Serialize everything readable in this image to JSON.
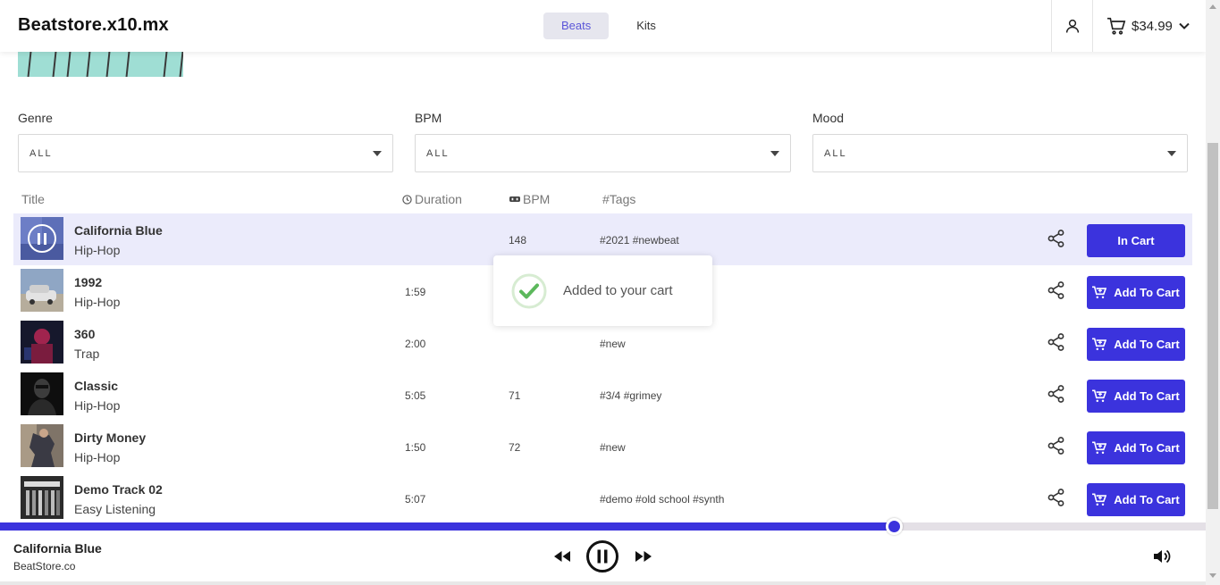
{
  "header": {
    "brand": "Beatstore.x10.mx",
    "tabs": [
      {
        "label": "Beats",
        "active": true
      },
      {
        "label": "Kits",
        "active": false
      }
    ],
    "cart_total": "$34.99"
  },
  "filters": {
    "genre": {
      "label": "Genre",
      "value": "ALL"
    },
    "bpm": {
      "label": "BPM",
      "value": "ALL"
    },
    "mood": {
      "label": "Mood",
      "value": "ALL"
    }
  },
  "table": {
    "headers": {
      "title": "Title",
      "duration": "Duration",
      "bpm": "BPM",
      "tags": "#Tags"
    },
    "rows": [
      {
        "title": "California Blue",
        "genre": "Hip-Hop",
        "duration": "",
        "bpm": "148",
        "tags": "#2021 #newbeat",
        "action": "In Cart",
        "in_cart": true,
        "playing": true
      },
      {
        "title": "1992",
        "genre": "Hip-Hop",
        "duration": "1:59",
        "bpm": "",
        "tags": "",
        "action": "Add To Cart",
        "in_cart": false,
        "playing": false
      },
      {
        "title": "360",
        "genre": "Trap",
        "duration": "2:00",
        "bpm": "",
        "tags": "#new",
        "action": "Add To Cart",
        "in_cart": false,
        "playing": false
      },
      {
        "title": "Classic",
        "genre": "Hip-Hop",
        "duration": "5:05",
        "bpm": "71",
        "tags": "#3/4 #grimey",
        "action": "Add To Cart",
        "in_cart": false,
        "playing": false
      },
      {
        "title": "Dirty Money",
        "genre": "Hip-Hop",
        "duration": "1:50",
        "bpm": "72",
        "tags": "#new",
        "action": "Add To Cart",
        "in_cart": false,
        "playing": false
      },
      {
        "title": "Demo Track 02",
        "genre": "Easy Listening",
        "duration": "5:07",
        "bpm": "",
        "tags": "#demo #old school #synth",
        "action": "Add To Cart",
        "in_cart": false,
        "playing": false
      }
    ]
  },
  "toast": {
    "message": "Added to your cart"
  },
  "player": {
    "track_title": "California Blue",
    "artist": "BeatStore.co",
    "progress_fraction": 0.741
  },
  "colors": {
    "accent": "#3b33dd",
    "active_row": "#ebebfb",
    "active_tab_text": "#5a55d8",
    "success_green": "#5cb85c"
  },
  "icons": {
    "user": "user-icon",
    "cart": "cart-icon",
    "share": "share-icon",
    "duration": "clock-icon",
    "bpm": "metronome-icon",
    "play_state": "pause-icon",
    "prev": "rewind-icon",
    "next": "fast-forward-icon",
    "volume": "volume-icon"
  }
}
